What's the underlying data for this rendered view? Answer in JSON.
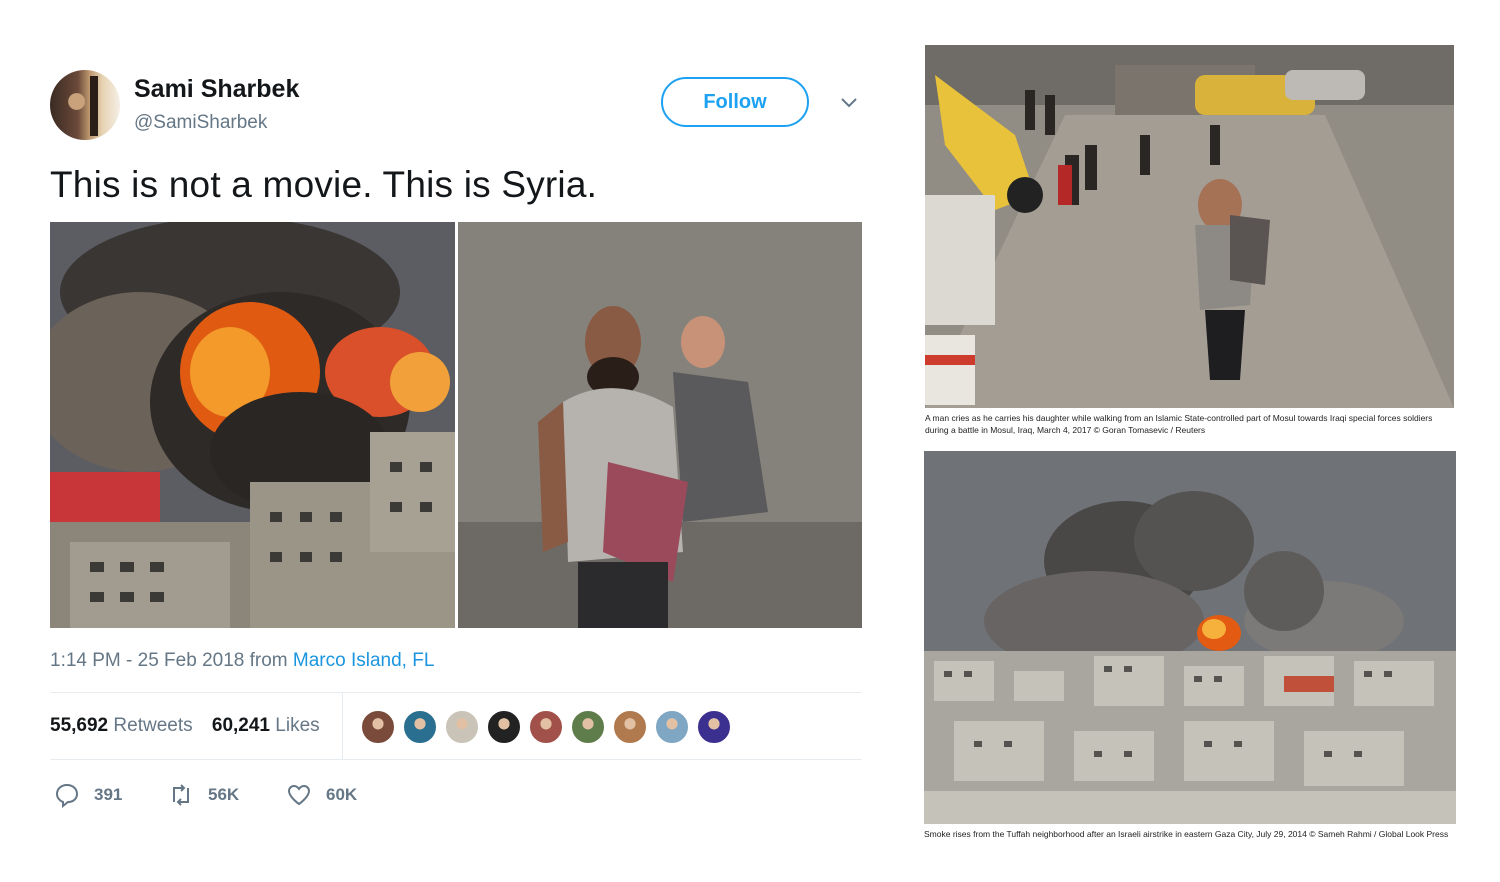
{
  "tweet": {
    "name": "Sami Sharbek",
    "handle": "@SamiSharbek",
    "follow_label": "Follow",
    "text": "This is not a movie. This is Syria.",
    "time": "1:14 PM - 25 Feb 2018 from",
    "location": "Marco Island, FL",
    "retweets_count": "55,692",
    "retweets_label": "Retweets",
    "likes_count": "60,241",
    "likes_label": "Likes",
    "reply_count": "391",
    "retweet_action_count": "56K",
    "like_action_count": "60K",
    "liker_colors": [
      "#7a4b3a",
      "#2a6f8f",
      "#c9c3b8",
      "#222222",
      "#a2514a",
      "#5f7d4a",
      "#b07a4e",
      "#7fa6c2",
      "#3b2f8f"
    ]
  },
  "news": {
    "caption1": "A man cries as he carries his daughter while walking from an Islamic State-controlled part of Mosul towards Iraqi special forces soldiers during a battle in Mosul, Iraq, March 4, 2017 © Goran Tomasevic / Reuters",
    "caption2": "Smoke rises from the Tuffah neighborhood after an Israeli airstrike in eastern Gaza City, July 29, 2014 © Sameh Rahmi / Global Look Press"
  },
  "colors": {
    "accent": "#1da1f2",
    "link": "#1b95e0",
    "muted": "#657786",
    "text": "#14171a"
  }
}
